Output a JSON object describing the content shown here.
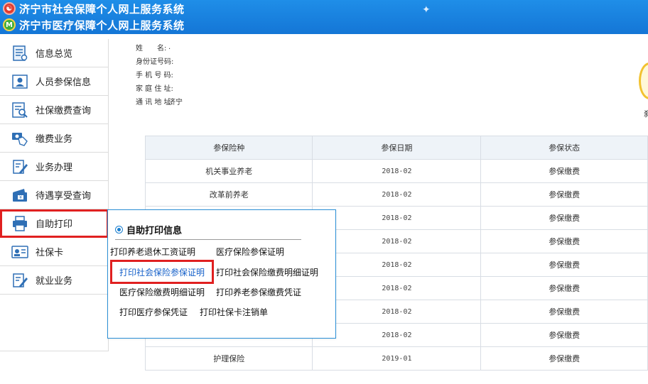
{
  "header": {
    "title1": "济宁市社会保障个人网上服务系统",
    "title2": "济宁市医疗保障个人网上服务系统",
    "logo2_char": "M",
    "spark": "✦"
  },
  "sidebar": {
    "items": [
      {
        "label": "信息总览",
        "icon": "document-list-icon"
      },
      {
        "label": "人员参保信息",
        "icon": "person-card-icon"
      },
      {
        "label": "社保缴费查询",
        "icon": "search-list-icon"
      },
      {
        "label": "缴费业务",
        "icon": "hand-money-icon"
      },
      {
        "label": "业务办理",
        "icon": "edit-form-icon"
      },
      {
        "label": "待遇享受查询",
        "icon": "wallet-icon"
      },
      {
        "label": "自助打印",
        "icon": "printer-icon"
      },
      {
        "label": "社保卡",
        "icon": "id-card-icon"
      },
      {
        "label": "就业业务",
        "icon": "edit-form-icon"
      }
    ]
  },
  "info": {
    "rows": [
      {
        "label": "姓　　名:",
        "value": "."
      },
      {
        "label": "身份证号码:",
        "value": ""
      },
      {
        "label": "手 机 号 码:",
        "value": ""
      },
      {
        "label": "家 庭 住 址:",
        "value": ""
      },
      {
        "label": "通 讯 地 址:",
        "value": "济宁"
      }
    ],
    "right_char": "刹"
  },
  "table": {
    "headers": [
      "参保险种",
      "参保日期",
      "参保状态"
    ],
    "rows": [
      [
        "机关事业养老",
        "2018-02",
        "参保缴费"
      ],
      [
        "改革前养老",
        "2018-02",
        "参保缴费"
      ],
      [
        "",
        "2018-02",
        "参保缴费"
      ],
      [
        "",
        "2018-02",
        "参保缴费"
      ],
      [
        "",
        "2018-02",
        "参保缴费"
      ],
      [
        "",
        "2018-02",
        "参保缴费"
      ],
      [
        "",
        "2018-02",
        "参保缴费"
      ],
      [
        "",
        "2018-02",
        "参保缴费"
      ],
      [
        "护理保险",
        "2019-01",
        "参保缴费"
      ]
    ]
  },
  "popup": {
    "title": "自助打印信息",
    "links": [
      "打印养老退休工资证明",
      "医疗保险参保证明",
      "打印社会保险参保证明",
      "打印社会保险缴费明细证明",
      "医疗保险缴费明细证明",
      "打印养老参保缴费凭证",
      "打印医疗参保凭证",
      "打印社保卡注销单"
    ]
  },
  "colors": {
    "header_blue": "#1a82df",
    "highlight_red": "#e02020",
    "popup_border": "#2a8fd6",
    "link_blue": "#1560c9"
  }
}
